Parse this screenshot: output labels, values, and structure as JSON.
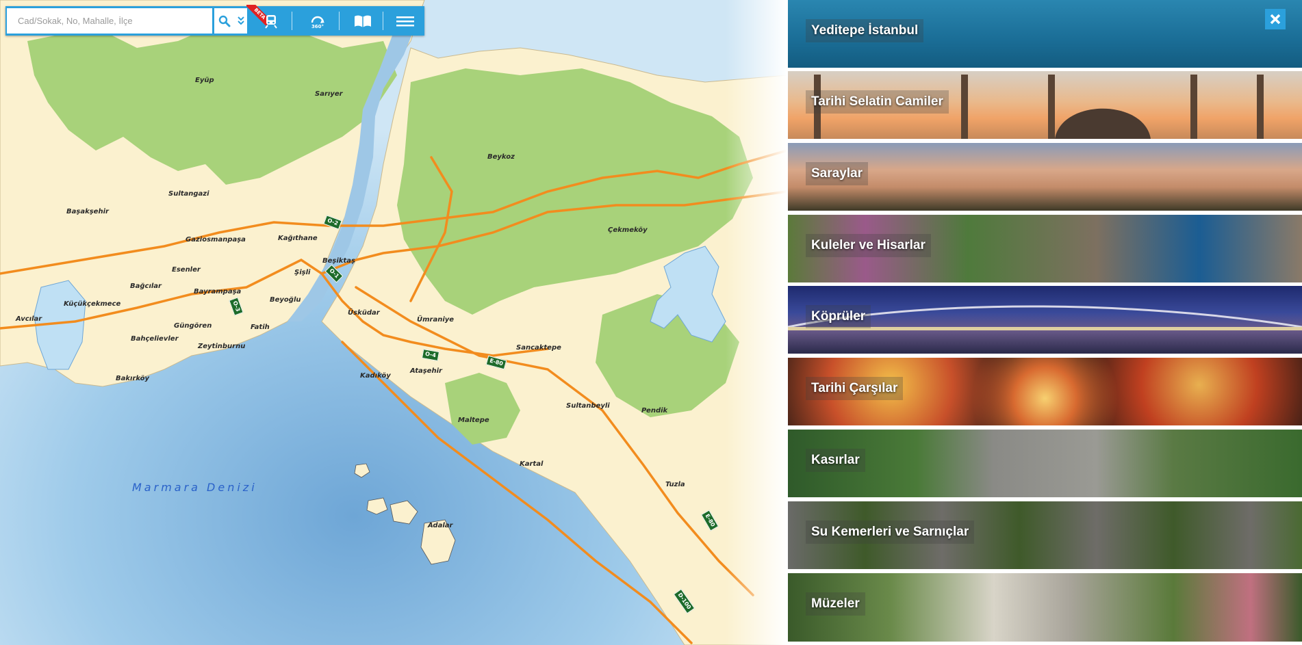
{
  "search": {
    "placeholder": "Cad/Sokak, No, Mahalle, İlçe",
    "beta_label": "BETA",
    "panorama_label": "360°"
  },
  "map": {
    "sea_label": "Marmara Denizi",
    "places": [
      "Eyüp",
      "Sarıyer",
      "Beykoz",
      "Sultangazi",
      "Başakşehir",
      "Gaziosmanpaşa",
      "Kağıthane",
      "Beşiktaş",
      "Çekmeköy",
      "Esenler",
      "Şişli",
      "Bağcılar",
      "Bayrampaşa",
      "Küçükçekmece",
      "Beyoğlu",
      "Üsküdar",
      "Ümraniye",
      "Avcılar",
      "Güngören",
      "Fatih",
      "Bahçelievler",
      "Zeytinburnu",
      "Sancaktepe",
      "Kadıköy",
      "Ataşehir",
      "Bakırköy",
      "Sultanbeyli",
      "Pendik",
      "Maltepe",
      "Kartal",
      "Tuzla",
      "Adalar"
    ],
    "road_shields": [
      "O-2",
      "O-1",
      "O-3",
      "O-4",
      "E-80",
      "E-80",
      "D-100"
    ]
  },
  "panel": {
    "categories": [
      {
        "title": "Yeditepe İstanbul"
      },
      {
        "title": "Tarihi Selatin Camiler"
      },
      {
        "title": "Saraylar"
      },
      {
        "title": "Kuleler ve Hisarlar"
      },
      {
        "title": "Köprüler"
      },
      {
        "title": "Tarihi Çarşılar"
      },
      {
        "title": "Kasırlar"
      },
      {
        "title": "Su Kemerleri ve Sarnıçlar"
      },
      {
        "title": "Müzeler"
      }
    ]
  },
  "colors": {
    "toolbar": "#2ba0dc",
    "sea": "#9ec7e6",
    "land": "#fbf1cf",
    "forest": "#a8d27a",
    "highway": "#f28c1e",
    "shield": "#1d6b2a"
  }
}
